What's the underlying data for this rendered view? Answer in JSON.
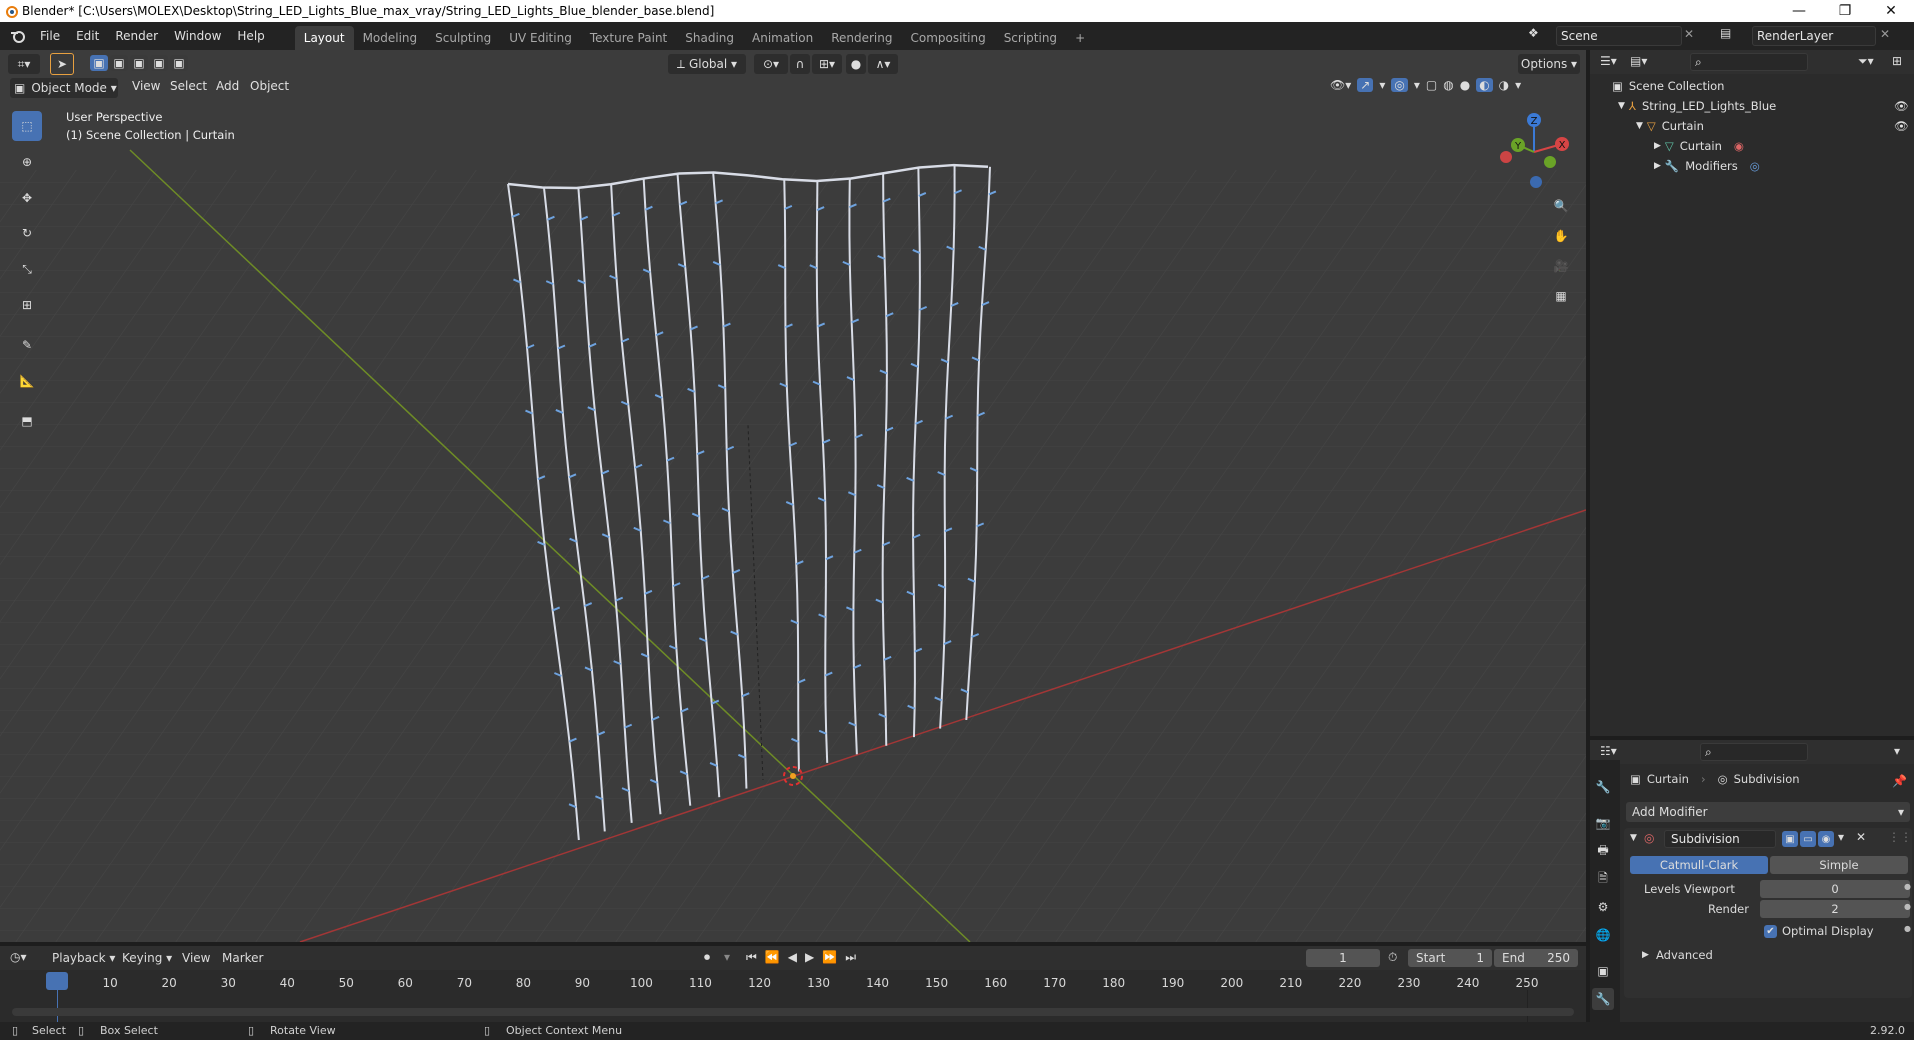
{
  "window": {
    "title": "Blender* [C:\\Users\\MOLEX\\Desktop\\String_LED_Lights_Blue_max_vray/String_LED_Lights_Blue_blender_base.blend]",
    "minimize": "—",
    "restore": "❐",
    "close": "✕"
  },
  "menu": [
    "File",
    "Edit",
    "Render",
    "Window",
    "Help"
  ],
  "workspaces": [
    "Layout",
    "Modeling",
    "Sculpting",
    "UV Editing",
    "Texture Paint",
    "Shading",
    "Animation",
    "Rendering",
    "Compositing",
    "Scripting"
  ],
  "add_workspace": "+",
  "scene": {
    "label": "Scene",
    "render_layer": "RenderLayer"
  },
  "viewport_header": {
    "transform_orientation": "Global",
    "options": "Options",
    "mode": "Object Mode",
    "menus": [
      "View",
      "Select",
      "Add",
      "Object"
    ]
  },
  "viewport": {
    "perspective": "User Perspective",
    "collection_info": "(1) Scene Collection | Curtain",
    "gizmo": {
      "x": "X",
      "y": "Y",
      "z": "Z"
    },
    "colors": {
      "bg": "#3c3c3c",
      "grid": "#4a4a4a",
      "x_axis": "#b33a3a",
      "y_axis": "#7a9a2a",
      "wire": "#d8dce6",
      "led": "#6ea2de"
    }
  },
  "outliner": {
    "rows": [
      {
        "label": "Scene Collection",
        "icon": "collection-icon"
      },
      {
        "label": "String_LED_Lights_Blue",
        "icon": "empty-icon"
      },
      {
        "label": "Curtain",
        "icon": "object-icon"
      },
      {
        "label": "Curtain",
        "icon": "mesh-icon"
      },
      {
        "label": "Modifiers",
        "icon": "wrench-icon"
      }
    ]
  },
  "properties": {
    "breadcrumb_object": "Curtain",
    "breadcrumb_modifier": "Subdivision",
    "add_modifier": "Add Modifier",
    "modifier_name": "Subdivision",
    "types": [
      "Catmull-Clark",
      "Simple"
    ],
    "levels_viewport_label": "Levels Viewport",
    "levels_viewport": "0",
    "render_label": "Render",
    "render": "2",
    "optimal_display": "Optimal Display",
    "advanced": "Advanced"
  },
  "timeline": {
    "menus": [
      "Playback",
      "Keying",
      "View",
      "Marker"
    ],
    "current_frame": "1",
    "start_label": "Start",
    "start": "1",
    "end_label": "End",
    "end": "250",
    "ticks": [
      "1",
      "10",
      "20",
      "30",
      "40",
      "50",
      "60",
      "70",
      "80",
      "90",
      "100",
      "110",
      "120",
      "130",
      "140",
      "150",
      "160",
      "170",
      "180",
      "190",
      "200",
      "210",
      "220",
      "230",
      "240",
      "250"
    ]
  },
  "statusbar": {
    "select": "Select",
    "box_select": "Box Select",
    "rotate_view": "Rotate View",
    "context_menu": "Object Context Menu",
    "version": "2.92.0"
  }
}
